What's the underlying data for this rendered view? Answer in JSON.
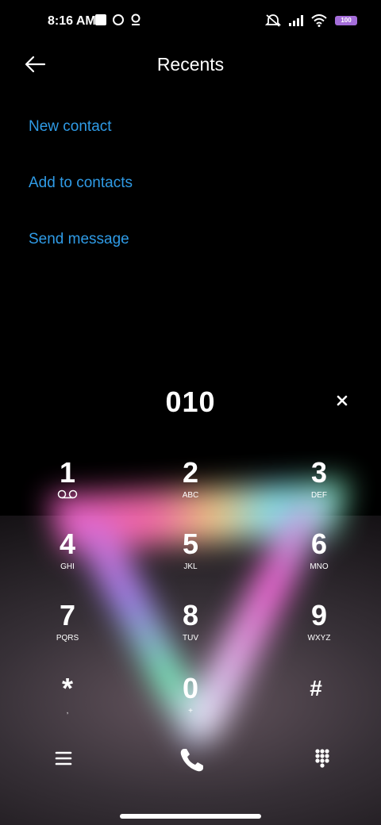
{
  "status_bar": {
    "time": "8:16 AM",
    "battery": "100"
  },
  "header": {
    "title": "Recents",
    "back_icon": "back-arrow-icon"
  },
  "actions": [
    {
      "label": "New contact"
    },
    {
      "label": "Add to contacts"
    },
    {
      "label": "Send message"
    }
  ],
  "dialer": {
    "number": "010",
    "keys": [
      {
        "digit": "1",
        "letters": ""
      },
      {
        "digit": "2",
        "letters": "ABC"
      },
      {
        "digit": "3",
        "letters": "DEF"
      },
      {
        "digit": "4",
        "letters": "GHI"
      },
      {
        "digit": "5",
        "letters": "JKL"
      },
      {
        "digit": "6",
        "letters": "MNO"
      },
      {
        "digit": "7",
        "letters": "PQRS"
      },
      {
        "digit": "8",
        "letters": "TUV"
      },
      {
        "digit": "9",
        "letters": "WXYZ"
      },
      {
        "digit": "*",
        "letters": ","
      },
      {
        "digit": "0",
        "letters": "+"
      },
      {
        "digit": "#",
        "letters": ""
      }
    ]
  },
  "colors": {
    "accent": "#2f9be6",
    "battery": "#a46dd9"
  }
}
